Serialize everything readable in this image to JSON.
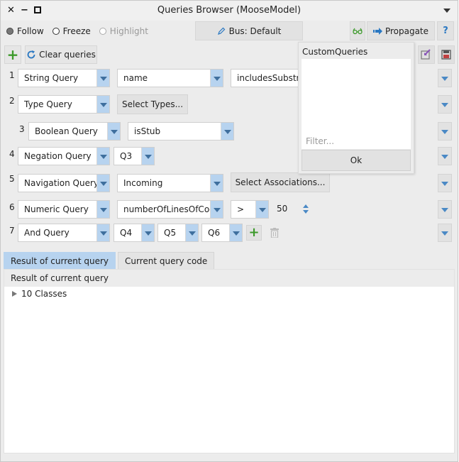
{
  "window": {
    "title": "Queries Browser (MooseModel)"
  },
  "toolbar": {
    "radio": [
      {
        "label": "Follow",
        "selected": true,
        "enabled": true
      },
      {
        "label": "Freeze",
        "selected": false,
        "enabled": true
      },
      {
        "label": "Highlight",
        "selected": false,
        "enabled": false
      }
    ],
    "bus_label": "Bus: Default",
    "propagate_label": "Propagate",
    "help_label": "?"
  },
  "toolbar2": {
    "add_label": "+",
    "clear_label": "Clear queries"
  },
  "queries": [
    {
      "num": "1",
      "type": "String Query",
      "property": "name",
      "operator": "includesSubstri"
    },
    {
      "num": "2",
      "type": "Type Query",
      "button": "Select Types..."
    },
    {
      "num": "3",
      "type": "Boolean Query",
      "property": "isStub"
    },
    {
      "num": "4",
      "type": "Negation Query",
      "operand": "Q3"
    },
    {
      "num": "5",
      "type": "Navigation Query",
      "direction": "Incoming",
      "button": "Select Associations..."
    },
    {
      "num": "6",
      "type": "Numeric Query",
      "property": "numberOfLinesOfCode",
      "comparator": ">",
      "value": "50"
    },
    {
      "num": "7",
      "type": "And Query",
      "operands": [
        "Q4",
        "Q5",
        "Q6"
      ],
      "add_label": "+"
    }
  ],
  "popup": {
    "title": "CustomQueries",
    "filter_placeholder": "Filter...",
    "ok_label": "Ok"
  },
  "results": {
    "tabs": [
      {
        "label": "Result of current query",
        "active": true
      },
      {
        "label": "Current query code",
        "active": false
      }
    ],
    "header": "Result of current query",
    "items": [
      {
        "label": "10 Classes"
      }
    ]
  },
  "colors": {
    "accent": "#b7d3ef",
    "add_green": "#3c9a2a",
    "icon_blue": "#2a78c2"
  }
}
